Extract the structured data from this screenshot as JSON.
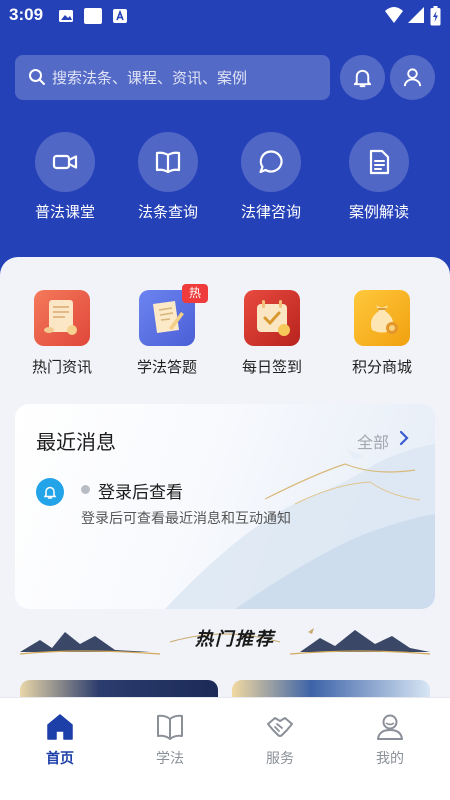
{
  "status_bar": {
    "time": "3:09"
  },
  "search": {
    "placeholder": "搜索法条、课程、资讯、案例"
  },
  "quick_nav": [
    {
      "label": "普法课堂",
      "icon": "video-icon"
    },
    {
      "label": "法条查询",
      "icon": "book-icon"
    },
    {
      "label": "法律咨询",
      "icon": "chat-icon"
    },
    {
      "label": "案例解读",
      "icon": "document-icon"
    }
  ],
  "features": [
    {
      "label": "热门资讯",
      "icon": "scroll-icon"
    },
    {
      "label": "学法答题",
      "icon": "quiz-icon",
      "badge": "热"
    },
    {
      "label": "每日签到",
      "icon": "calendar-check-icon"
    },
    {
      "label": "积分商城",
      "icon": "coin-bag-icon"
    }
  ],
  "messages": {
    "title": "最近消息",
    "all_label": "全部",
    "item_title": "登录后查看",
    "item_subtitle": "登录后可查看最近消息和互动通知"
  },
  "hot_section": {
    "title": "热门推荐"
  },
  "tabbar": [
    {
      "label": "首页",
      "active": true
    },
    {
      "label": "学法",
      "active": false
    },
    {
      "label": "服务",
      "active": false
    },
    {
      "label": "我的",
      "active": false
    }
  ],
  "colors": {
    "primary": "#2541b8",
    "active_tab": "#1d3fa8",
    "badge": "#ef3b3b",
    "bell": "#23a3e8"
  }
}
